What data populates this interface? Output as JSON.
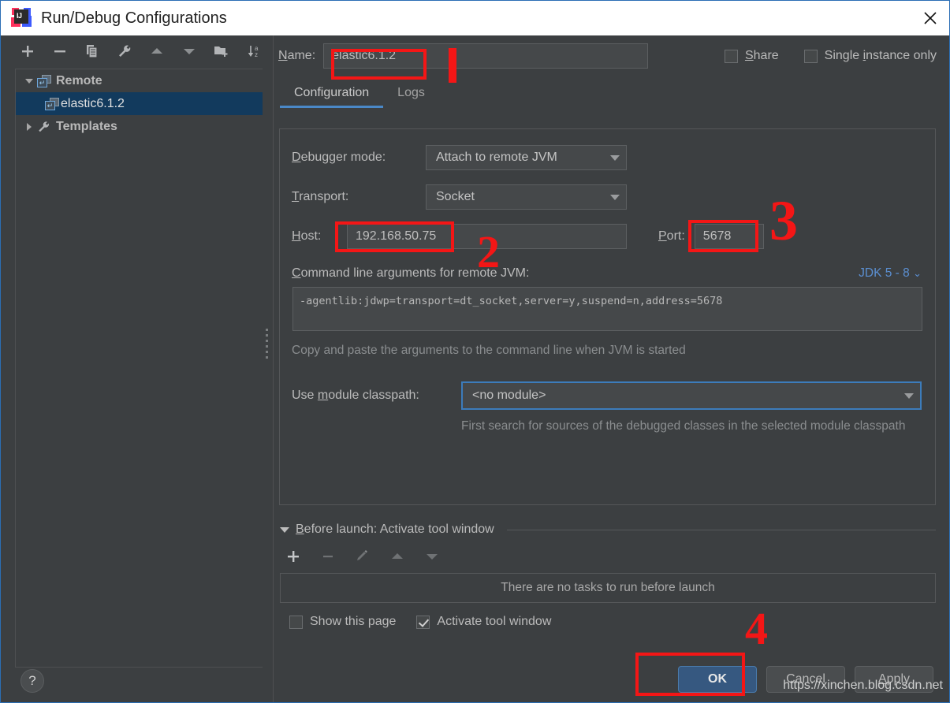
{
  "window": {
    "title": "Run/Debug Configurations",
    "logo_icon": "intellij-idea-logo",
    "close_icon": "close-icon"
  },
  "tree_toolbar": {
    "items": [
      {
        "name": "add-configuration-button",
        "icon": "plus-icon",
        "glyph": "+"
      },
      {
        "name": "remove-configuration-button",
        "icon": "minus-icon",
        "glyph": "−"
      },
      {
        "name": "copy-configuration-button",
        "icon": "copy-icon",
        "glyph": "❐"
      },
      {
        "name": "edit-templates-button",
        "icon": "wrench-icon",
        "glyph": "🔧"
      },
      {
        "name": "move-up-button",
        "icon": "arrow-up-icon",
        "glyph": "▲"
      },
      {
        "name": "move-down-button",
        "icon": "arrow-down-icon",
        "glyph": "▼"
      },
      {
        "name": "new-folder-button",
        "icon": "new-folder-icon",
        "glyph": "📁"
      },
      {
        "name": "sort-alphabetically-button",
        "icon": "sort-az-icon",
        "glyph": "↓az"
      }
    ]
  },
  "tree": {
    "items": [
      {
        "label": "Remote",
        "icon": "remote-config-icon",
        "expanded": true,
        "selected": false,
        "level": 0
      },
      {
        "label": "elastic6.1.2",
        "icon": "remote-config-icon",
        "expanded": false,
        "selected": true,
        "level": 1
      },
      {
        "label": "Templates",
        "icon": "wrench-icon",
        "expanded": false,
        "selected": false,
        "level": 0
      }
    ]
  },
  "help_button": {
    "label": "?",
    "icon": "question-mark-icon"
  },
  "name_row": {
    "label": "Name:",
    "value": "elastic6.1.2",
    "placeholder": "Name"
  },
  "options": {
    "share": {
      "label": "Share",
      "checked": false
    },
    "single_instance": {
      "label": "Single instance only",
      "checked": false
    }
  },
  "tabs": [
    {
      "label": "Configuration",
      "active": true
    },
    {
      "label": "Logs",
      "active": false
    }
  ],
  "configuration": {
    "debugger_mode": {
      "label": "Debugger mode:",
      "value": "Attach to remote JVM"
    },
    "transport": {
      "label": "Transport:",
      "value": "Socket"
    },
    "host": {
      "label": "Host:",
      "value": "192.168.50.75"
    },
    "port": {
      "label": "Port:",
      "value": "5678"
    },
    "command_line": {
      "label": "Command line arguments for remote JVM:",
      "jdk_selector": "JDK 5 - 8",
      "value": "-agentlib:jdwp=transport=dt_socket,server=y,suspend=n,address=5678",
      "hint": "Copy and paste the arguments to the command line when JVM is started"
    },
    "module_classpath": {
      "label": "Use module classpath:",
      "value": "<no module>",
      "hint": "First search for sources of the debugged classes in the selected module classpath"
    }
  },
  "before_launch": {
    "title": "Before launch: Activate tool window",
    "toolbar": [
      {
        "name": "add-task-button",
        "icon": "plus-icon",
        "glyph": "+",
        "enabled": true
      },
      {
        "name": "remove-task-button",
        "icon": "minus-icon",
        "glyph": "−",
        "enabled": false
      },
      {
        "name": "edit-task-button",
        "icon": "pencil-icon",
        "glyph": "✎",
        "enabled": false
      },
      {
        "name": "move-task-up-button",
        "icon": "arrow-up-icon",
        "glyph": "▲",
        "enabled": false
      },
      {
        "name": "move-task-down-button",
        "icon": "arrow-down-icon",
        "glyph": "▼",
        "enabled": false
      }
    ],
    "empty_text": "There are no tasks to run before launch",
    "show_this_page": {
      "label": "Show this page",
      "checked": false
    },
    "activate_tool_window": {
      "label": "Activate tool window",
      "checked": true
    }
  },
  "dialog_buttons": {
    "ok": "OK",
    "cancel": "Cancel",
    "apply": "Apply"
  },
  "annotations": {
    "marker_color": "#f41616",
    "markers": [
      {
        "label": "1",
        "target": "name-field"
      },
      {
        "label": "2",
        "target": "host-field"
      },
      {
        "label": "3",
        "target": "port-field"
      },
      {
        "label": "4",
        "target": "ok-button"
      }
    ]
  },
  "watermark": "https://xinchen.blog.csdn.net"
}
